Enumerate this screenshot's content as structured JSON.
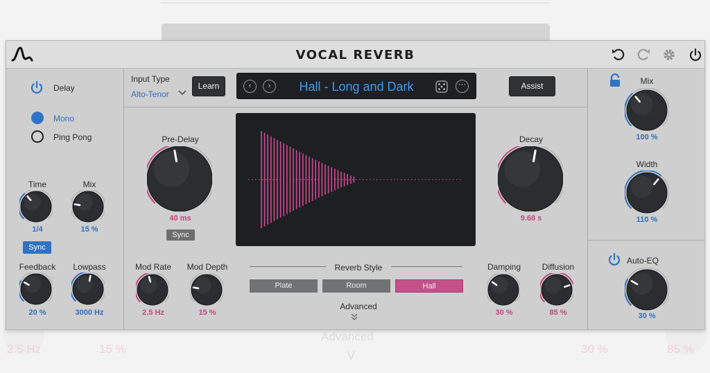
{
  "app": {
    "title": "VOCAL REVERB"
  },
  "input": {
    "label": "Input Type",
    "value": "Alto-Tenor",
    "learn_label": "Learn"
  },
  "preset": {
    "name": "Hall - Long and Dark"
  },
  "assist_label": "Assist",
  "delay": {
    "label": "Delay",
    "modes": [
      "Mono",
      "Ping Pong"
    ],
    "selected_mode": "Mono",
    "time_label": "Time",
    "time_value": "1/4",
    "mix_label": "Mix",
    "mix_value": "15 %",
    "sync_label": "Sync",
    "feedback_label": "Feedback",
    "feedback_value": "20 %",
    "lowpass_label": "Lowpass",
    "lowpass_value": "3000 Hz"
  },
  "reverb": {
    "predelay_label": "Pre-Delay",
    "predelay_value": "40 ms",
    "predelay_sync_label": "Sync",
    "decay_label": "Decay",
    "decay_value": "9.68 s",
    "modrate_label": "Mod Rate",
    "modrate_value": "2.5 Hz",
    "moddepth_label": "Mod Depth",
    "moddepth_value": "15 %",
    "style_label": "Reverb Style",
    "styles": [
      "Plate",
      "Room",
      "Hall"
    ],
    "selected_style": "Hall",
    "advanced_label": "Advanced",
    "damping_label": "Damping",
    "damping_value": "30 %",
    "diffusion_label": "Diffusion",
    "diffusion_value": "85 %"
  },
  "output": {
    "mix_label": "Mix",
    "mix_value": "100 %",
    "width_label": "Width",
    "width_value": "110 %",
    "autoeq_label": "Auto-EQ",
    "autoeq_value": "30 %"
  },
  "background": {
    "modrate_value": "2.5 Hz",
    "moddepth_value": "15 %",
    "advanced_label": "Advanced",
    "damping_value": "30 %",
    "diffusion_value": "85 %"
  },
  "colors": {
    "accent_blue": "#2f73c5",
    "accent_pink": "#c0487f",
    "hall_button": "#c5518a",
    "style_button_gray": "#707274",
    "display_bg": "#1e1f22",
    "waveform": "#d24c95"
  }
}
